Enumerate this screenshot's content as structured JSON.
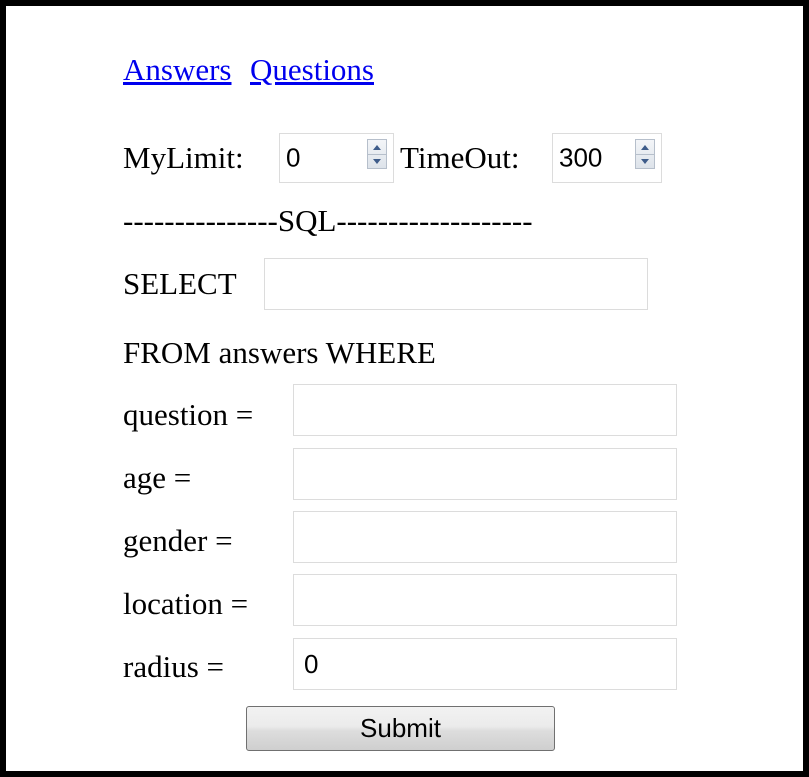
{
  "nav": {
    "answers_link": "Answers",
    "questions_link": "Questions"
  },
  "limits": {
    "mylimit_label": "MyLimit:",
    "mylimit_value": "0",
    "timeout_label": "TimeOut:",
    "timeout_value": "300"
  },
  "sql": {
    "divider": "---------------SQL-------------------",
    "select_label": "SELECT",
    "select_value": "",
    "from_clause": "FROM answers WHERE"
  },
  "filters": {
    "question_label": "question =",
    "question_value": "",
    "age_label": "age =",
    "age_value": "",
    "gender_label": "gender =",
    "gender_value": "",
    "location_label": "location =",
    "location_value": "",
    "radius_label": "radius =",
    "radius_value": "0"
  },
  "form": {
    "submit_label": "Submit"
  },
  "colors": {
    "link": "#0000ee",
    "frame_border": "#000000",
    "input_border": "#dcdcdc"
  }
}
